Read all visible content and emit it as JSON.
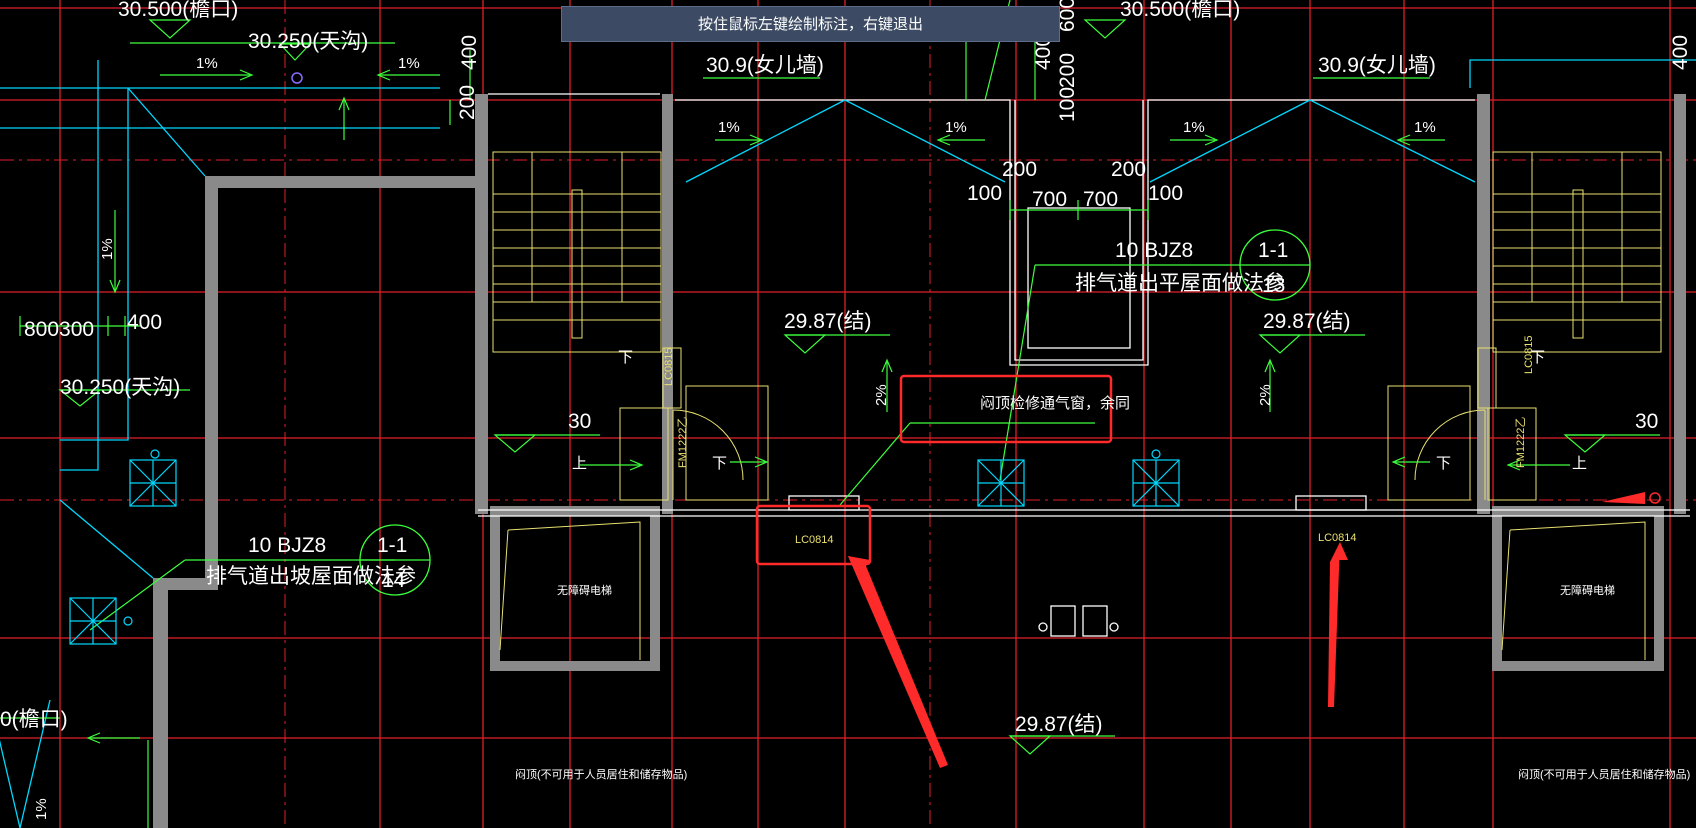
{
  "tooltip": "按住鼠标左键绘制标注，右键退出",
  "colors": {
    "background": "#000000",
    "axis": "#e0202a",
    "wall": "#ffffff",
    "slope": "#00d8ff",
    "dim": "#ffffff",
    "green": "#3cff3c",
    "yellow": "#e8e070",
    "markup": "#ff2a2a"
  },
  "labels": {
    "eave_top_left": "30.500(檐口)",
    "eave_top_right": "30.500(檐口)",
    "gutter_top": "30.250(天沟)",
    "gutter_left": "30.250(天沟)",
    "parapet_left": "30.9(女儿墙)",
    "parapet_right": "30.9(女儿墙)",
    "struct_left": "29.87(结)",
    "struct_right": "29.87(结)",
    "struct_bottom": "29.87(结)",
    "eave_bottom_left": "0(檐口)",
    "dim_800300": "800300",
    "dim_400_left": "400",
    "dim_400_top": "400",
    "dim_200_left": "200",
    "dim_600_top": "600",
    "dim_400_mid": "400",
    "dim_200_mid": "200",
    "dim_100_mid": "100",
    "dim_400_far": "400",
    "dim_200_a": "200",
    "dim_200_b": "200",
    "dim_100_a": "100",
    "dim_100_b": "100",
    "dim_700_a": "700",
    "dim_700_b": "700",
    "dim_30_left": "30",
    "dim_30_right": "30",
    "ref_upper_code": "10 BJZ8",
    "ref_upper_note": "排气道出平屋面做法参",
    "ref_upper_num": "1-1",
    "ref_upper_sheet": "13",
    "ref_lower_code": "10 BJZ8",
    "ref_lower_note": "排气道出坡屋面做法参",
    "ref_lower_num": "1-1",
    "ref_lower_sheet": "14",
    "slope_1pct": "1%",
    "slope_2pct": "2%",
    "vent_note": "闷顶检修通气窗，余同",
    "window_lc0814_left": "LC0814",
    "window_lc0814_right": "LC0814",
    "window_lc0815_left": "LC0815",
    "window_lc0815_right": "LC0815",
    "door_left": "FM1222乙",
    "door_right": "FM1222乙",
    "elevator_left": "无障碍电梯",
    "elevator_right": "无障碍电梯",
    "attic_left": "闷顶(不可用于人员居住和储存物品)",
    "attic_right": "闷顶(不可用于人员居住和储存物品)",
    "stair_up": "上",
    "stair_down": "下"
  }
}
